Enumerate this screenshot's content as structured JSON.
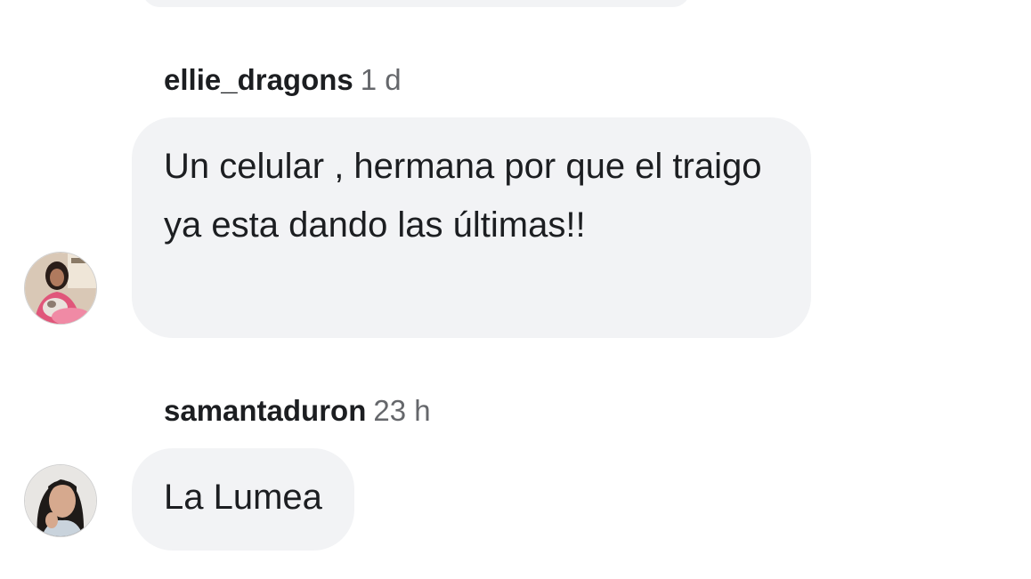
{
  "comments": [
    {
      "author": "ellie_dragons",
      "time": "1 d",
      "text": "Un celular , hermana por que el traigo ya esta dando las últimas!!"
    },
    {
      "author": "samantaduron",
      "time": "23 h",
      "text": "La Lumea"
    }
  ]
}
